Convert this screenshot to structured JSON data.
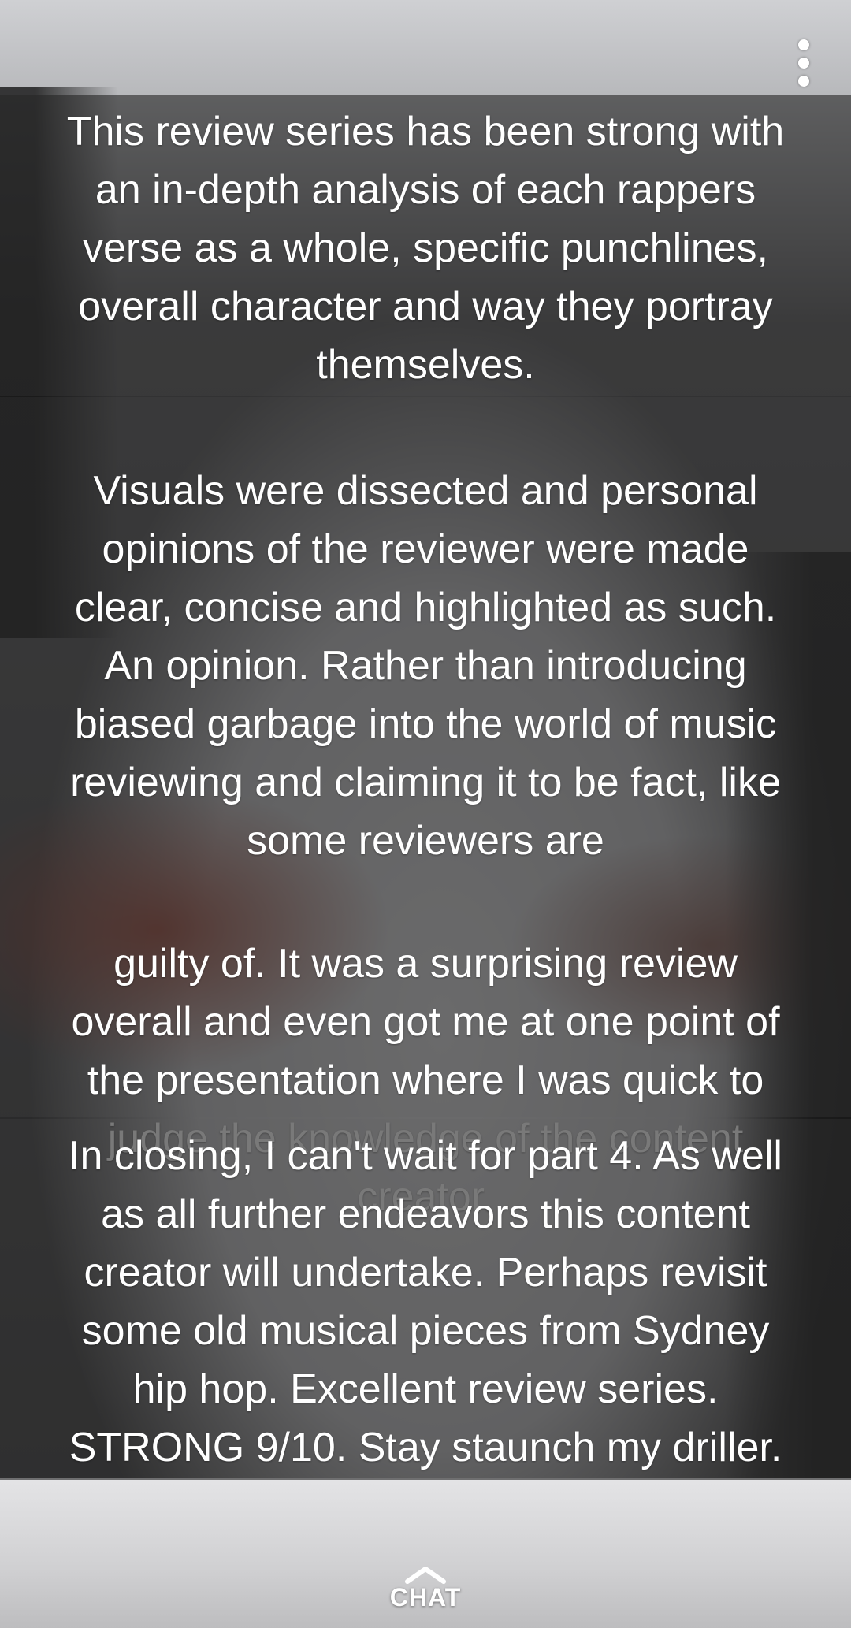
{
  "captions": {
    "block1": "This review series has been strong with\nan in-depth analysis of each rappers\nverse as a whole, specific punchlines,\noverall character  and way they portray\nthemselves.",
    "block2a": "Visuals were dissected and personal\nopinions of the reviewer were made\nclear, concise and highlighted as such.\nAn opinion. Rather than introducing\nbiased garbage into the world of music\nreviewing and claiming it to be fact, like\nsome reviewers are",
    "block2b": "guilty of. It was a surprising review\noverall and even got me at one point of\nthe presentation where I was quick to\njudge the knowledge of the content\ncreator.",
    "block3": "In closing, I can't wait for part 4. As well\nas all further endeavors this content\ncreator will undertake. Perhaps revisit\nsome old musical pieces from Sydney\nhip hop. Excellent review series.\nSTRONG 9/10. Stay staunch my driller."
  },
  "chat": {
    "label": "CHAT",
    "icon": "chevron-up-icon"
  },
  "menu": {
    "icon": "more-vertical-icon"
  },
  "colors": {
    "caption_bg": "#262626",
    "text": "#ffffff"
  }
}
